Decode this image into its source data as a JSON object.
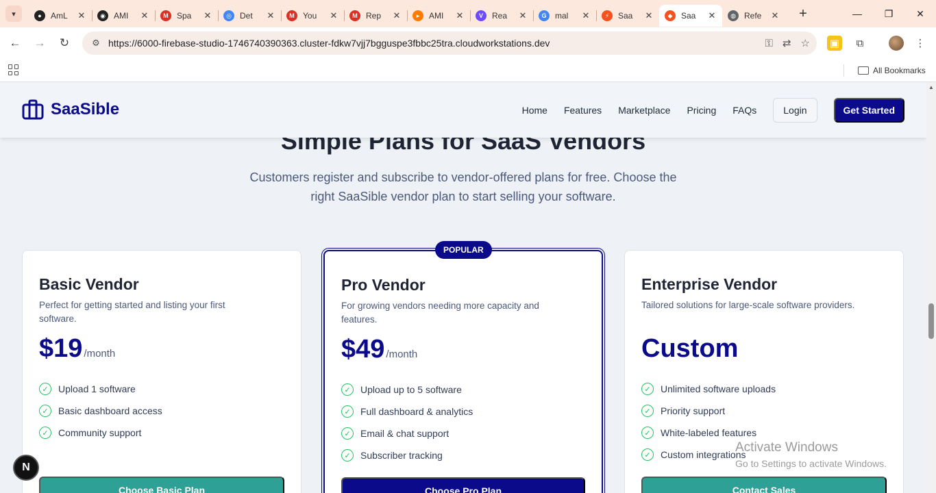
{
  "browser": {
    "tabs": [
      {
        "title": "AmL",
        "color": "#222222"
      },
      {
        "title": "AMI",
        "color": "#222222"
      },
      {
        "title": "Spa",
        "color": "#d93025"
      },
      {
        "title": "Det",
        "color": "#4285f4"
      },
      {
        "title": "You",
        "color": "#d93025"
      },
      {
        "title": "Rep",
        "color": "#d93025"
      },
      {
        "title": "AMI",
        "color": "#ff7a00"
      },
      {
        "title": "Rea",
        "color": "#6d4aff"
      },
      {
        "title": "mal",
        "color": "#4285f4"
      },
      {
        "title": "Saa",
        "color": "#f4511e"
      },
      {
        "title": "Saa",
        "color": "#f4511e",
        "active": true
      },
      {
        "title": "Refe",
        "color": "#5f6368"
      }
    ],
    "url": "https://6000-firebase-studio-1746740390363.cluster-fdkw7vjj7bgguspe3fbbc25tra.cloudworkstations.dev",
    "bookmarks_label": "All Bookmarks"
  },
  "site": {
    "brand": "SaaSible",
    "nav": [
      "Home",
      "Features",
      "Marketplace",
      "Pricing",
      "FAQs"
    ],
    "login": "Login",
    "get_started": "Get Started",
    "headline": "Simple Plans for SaaS Vendors",
    "subline": "Customers register and subscribe to vendor-offered plans for free. Choose the right SaaSible vendor plan to start selling your software.",
    "popular_badge": "POPULAR"
  },
  "plans": [
    {
      "name": "Basic Vendor",
      "description": "Perfect for getting started and listing your first software.",
      "price": "$19",
      "period": "/month",
      "features": [
        "Upload 1 software",
        "Basic dashboard access",
        "Community support"
      ],
      "button": "Choose Basic Plan"
    },
    {
      "name": "Pro Vendor",
      "description": "For growing vendors needing more capacity and features.",
      "price": "$49",
      "period": "/month",
      "features": [
        "Upload up to 5 software",
        "Full dashboard & analytics",
        "Email & chat support",
        "Subscriber tracking"
      ],
      "button": "Choose Pro Plan"
    },
    {
      "name": "Enterprise Vendor",
      "description": "Tailored solutions for large-scale software providers.",
      "price": "Custom",
      "period": "",
      "features": [
        "Unlimited software uploads",
        "Priority support",
        "White-labeled features",
        "Custom integrations"
      ],
      "button": "Contact Sales"
    }
  ],
  "dev_badge": "N",
  "watermark": {
    "title": "Activate Windows",
    "subtitle": "Go to Settings to activate Windows."
  }
}
